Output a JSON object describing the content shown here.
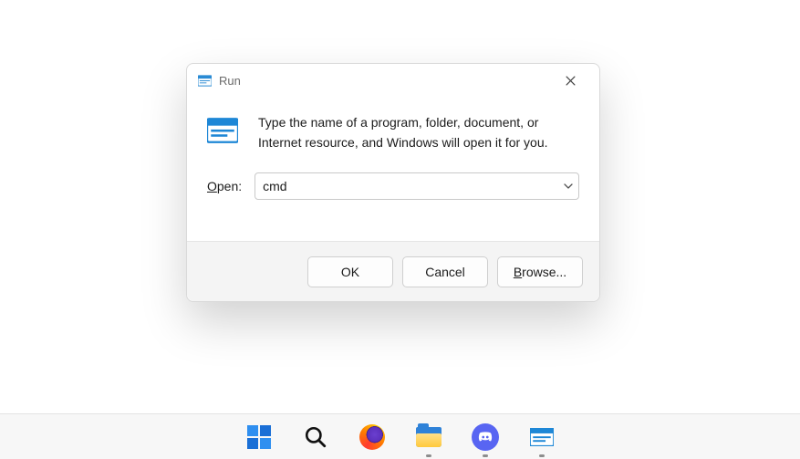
{
  "dialog": {
    "title": "Run",
    "message": "Type the name of a program, folder, document, or Internet resource, and Windows will open it for you.",
    "open_label_u": "O",
    "open_label_rest": "pen:",
    "input_value": "cmd",
    "buttons": {
      "ok": "OK",
      "cancel": "Cancel",
      "browse_u": "B",
      "browse_rest": "rowse..."
    }
  },
  "taskbar": {
    "items": [
      {
        "name": "start"
      },
      {
        "name": "search"
      },
      {
        "name": "firefox"
      },
      {
        "name": "file-explorer",
        "running": true
      },
      {
        "name": "discord",
        "running": true
      },
      {
        "name": "run",
        "running": true
      }
    ]
  }
}
